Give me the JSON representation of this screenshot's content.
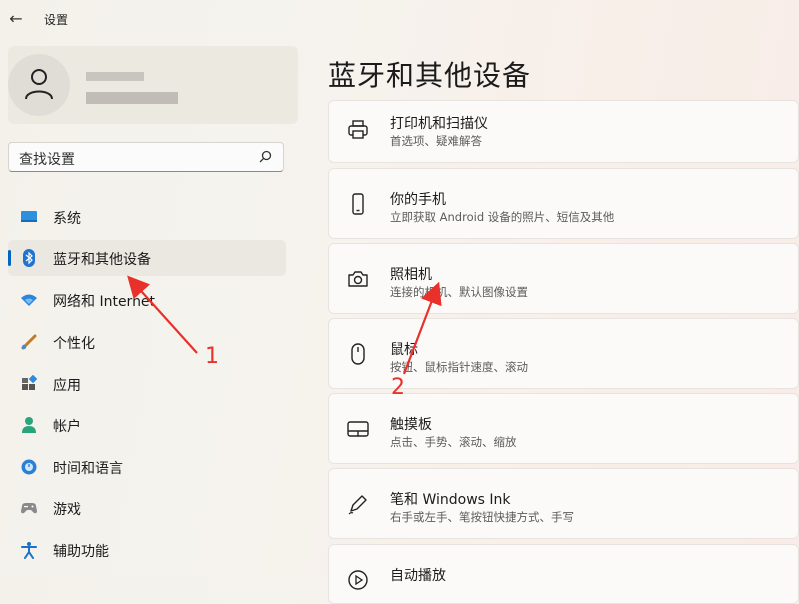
{
  "window": {
    "back_icon": "back-arrow-icon",
    "title": "设置"
  },
  "search": {
    "placeholder": "查找设置"
  },
  "sidebar": {
    "items": [
      {
        "label": "系统",
        "icon": "system-icon"
      },
      {
        "label": "蓝牙和其他设备",
        "icon": "bluetooth-icon",
        "active": true
      },
      {
        "label": "网络和 Internet",
        "icon": "network-icon"
      },
      {
        "label": "个性化",
        "icon": "personalization-icon"
      },
      {
        "label": "应用",
        "icon": "apps-icon"
      },
      {
        "label": "帐户",
        "icon": "account-icon"
      },
      {
        "label": "时间和语言",
        "icon": "time-language-icon"
      },
      {
        "label": "游戏",
        "icon": "gaming-icon"
      },
      {
        "label": "辅助功能",
        "icon": "accessibility-icon"
      }
    ]
  },
  "main": {
    "heading": "蓝牙和其他设备",
    "cards": [
      {
        "title": "打印机和扫描仪",
        "subtitle": "首选项、疑难解答",
        "icon": "printer-icon"
      },
      {
        "title": "你的手机",
        "subtitle": "立即获取 Android 设备的照片、短信及其他",
        "icon": "phone-icon"
      },
      {
        "title": "照相机",
        "subtitle": "连接的相机、默认图像设置",
        "icon": "camera-icon"
      },
      {
        "title": "鼠标",
        "subtitle": "按钮、鼠标指针速度、滚动",
        "icon": "mouse-icon"
      },
      {
        "title": "触摸板",
        "subtitle": "点击、手势、滚动、缩放",
        "icon": "touchpad-icon"
      },
      {
        "title": "笔和 Windows Ink",
        "subtitle": "右手或左手、笔按钮快捷方式、手写",
        "icon": "pen-icon"
      },
      {
        "title": "自动播放",
        "subtitle": "",
        "icon": "autoplay-icon"
      }
    ]
  },
  "annotations": {
    "label_1": "1",
    "label_2": "2",
    "color": "#e8312a"
  },
  "colors": {
    "accent": "#0067c0"
  }
}
